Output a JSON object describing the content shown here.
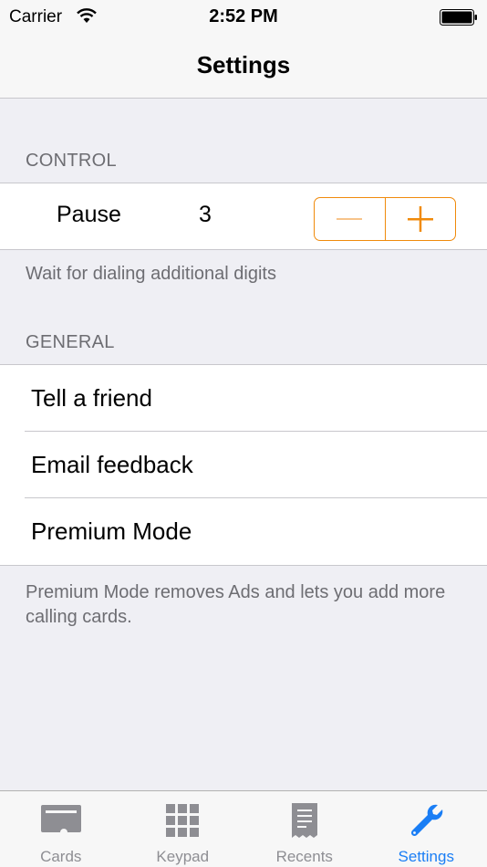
{
  "status_bar": {
    "carrier": "Carrier",
    "time": "2:52 PM"
  },
  "nav": {
    "title": "Settings"
  },
  "control": {
    "header": "CONTROL",
    "pause_label": "Pause",
    "pause_value": "3",
    "footer": "Wait for dialing additional digits",
    "stepper_color": "#f08a0b"
  },
  "general": {
    "header": "GENERAL",
    "items": [
      {
        "label": "Tell a friend"
      },
      {
        "label": "Email feedback"
      },
      {
        "label": "Premium Mode"
      }
    ],
    "footer": "Premium Mode removes Ads and lets you add more calling cards."
  },
  "tab_bar": {
    "tabs": [
      {
        "label": "Cards",
        "icon": "card-icon"
      },
      {
        "label": "Keypad",
        "icon": "keypad-icon"
      },
      {
        "label": "Recents",
        "icon": "receipt-icon"
      },
      {
        "label": "Settings",
        "icon": "wrench-icon",
        "active": true
      }
    ],
    "active_color": "#1a7ef5",
    "inactive_color": "#8e8e93"
  }
}
